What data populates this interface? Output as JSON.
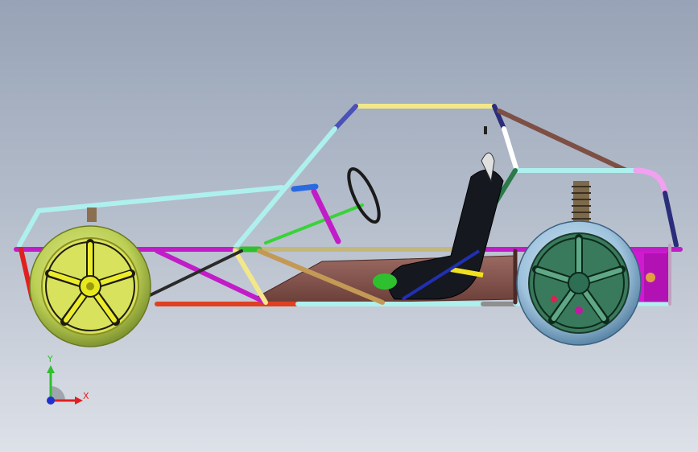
{
  "viewport": {
    "background_top": "#97a3b6",
    "background_bottom": "#dde1e8"
  },
  "triad": {
    "y_label": "Y",
    "x_label": "X",
    "y_color": "#2fbf2f",
    "x_color": "#e02020",
    "z_color": "#2030d0"
  },
  "model": {
    "front_wheel": {
      "tire": "#bccf55",
      "rim": "#e8e81e"
    },
    "rear_wheel": {
      "tire": "#9fc3dd",
      "rim": "#2e6e54"
    },
    "frame_colors": [
      "#aef0ee",
      "#f2e88a",
      "#7e4f44",
      "#2a2e7a",
      "#c39955",
      "#c21cc8",
      "#e04020",
      "#ffffff"
    ],
    "floor": "#7e4f4a",
    "seat": "#15181f",
    "seat_accent": "#f0e020",
    "spring": "#7d6a4a",
    "rear_plate": "#d01ad0"
  }
}
